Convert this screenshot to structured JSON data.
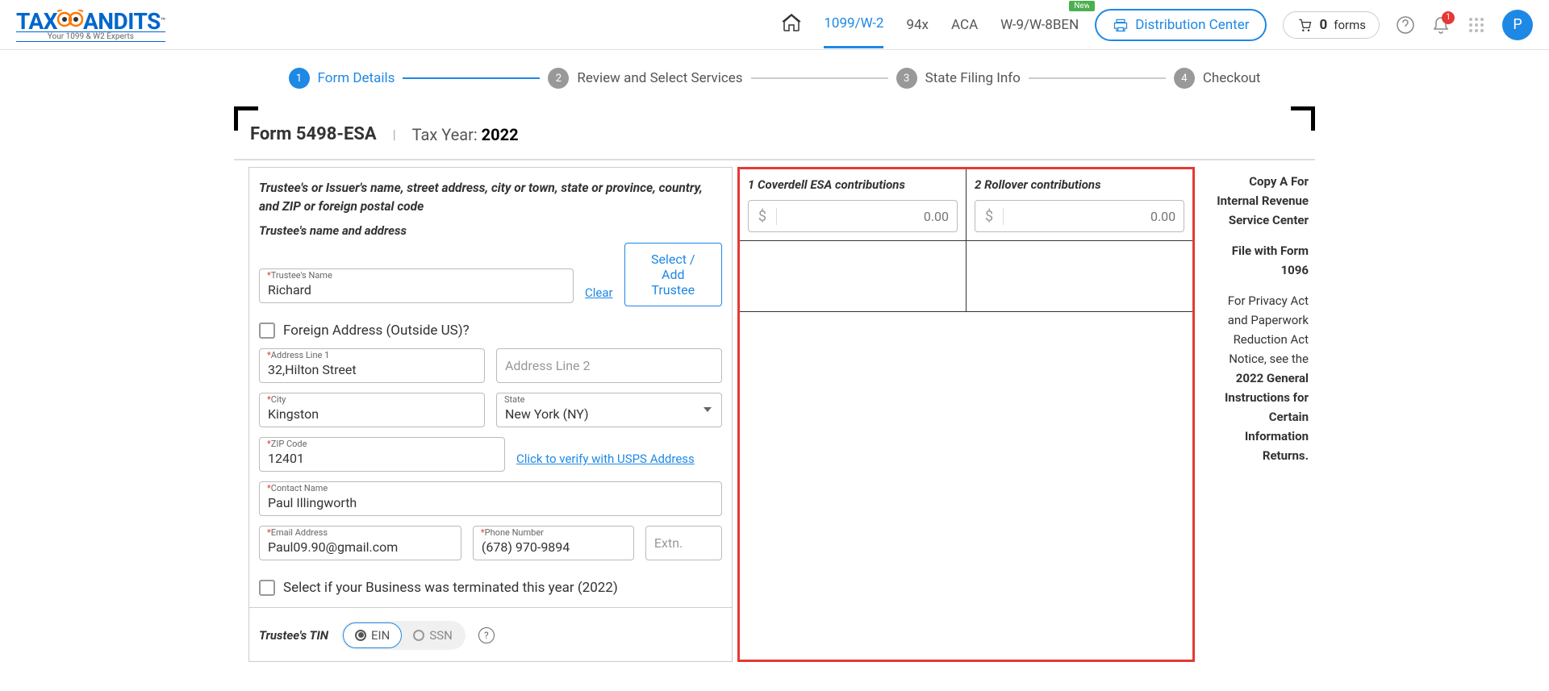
{
  "header": {
    "logo_text1": "TAX",
    "logo_text2": "ANDITS",
    "logo_tm": "™",
    "logo_sub": "Your 1099 & W2 Experts",
    "nav": {
      "n1099": "1099/W-2",
      "n94x": "94x",
      "aca": "ACA",
      "w9": "W-9/W-8BEN",
      "new_badge": "New"
    },
    "dist_center": "Distribution Center",
    "forms_count": "0",
    "forms_label": "forms",
    "notif_count": "1",
    "avatar": "P"
  },
  "stepper": {
    "s1": "Form Details",
    "s2": "Review and Select Services",
    "s3": "State Filing Info",
    "s4": "Checkout"
  },
  "form_header": {
    "title": "Form 5498-ESA",
    "tax_year_label": "Tax Year:",
    "tax_year": "2022"
  },
  "trustee": {
    "section_title": "Trustee's or Issuer's name, street address, city or town, state or province, country, and ZIP or foreign postal code",
    "sub_title": "Trustee's name and address",
    "name_label": "Trustee's Name",
    "name_value": "Richard",
    "clear": "Clear",
    "select_add": "Select / Add Trustee",
    "foreign_label": "Foreign Address (Outside US)?",
    "addr1_label": "Address Line 1",
    "addr1_value": "32,Hilton Street",
    "addr2_placeholder": "Address Line 2",
    "city_label": "City",
    "city_value": "Kingston",
    "state_label": "State",
    "state_value": "New York (NY)",
    "zip_label": "ZIP Code",
    "zip_value": "12401",
    "verify_link": "Click to verify with USPS Address",
    "contact_label": "Contact Name",
    "contact_value": "Paul Illingworth",
    "email_label": "Email Address",
    "email_value": "Paul09.90@gmail.com",
    "phone_label": "Phone Number",
    "phone_value": "(678) 970-9894",
    "extn_placeholder": "Extn.",
    "terminated_label": "Select if your Business was terminated this year (2022)"
  },
  "tin": {
    "label": "Trustee's TIN",
    "ein": "EIN",
    "ssn": "SSN"
  },
  "contributions": {
    "c1_label": "1 Coverdell ESA contributions",
    "c2_label": "2 Rollover contributions",
    "placeholder": "0.00",
    "dollar": "$"
  },
  "right": {
    "copy_a": "Copy A For Internal Revenue Service Center",
    "file_with": "File with Form 1096",
    "privacy1": "For Privacy Act and Paperwork Reduction Act Notice, see the ",
    "privacy2": "2022 General Instructions for Certain Information Returns."
  }
}
